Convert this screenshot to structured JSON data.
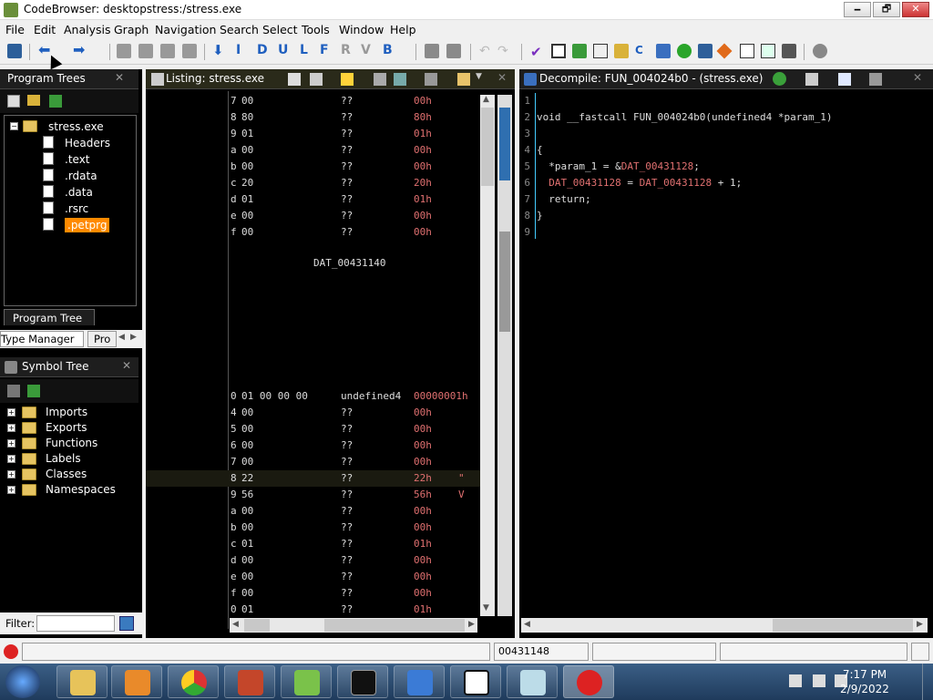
{
  "window": {
    "title": "CodeBrowser: desktopstress:/stress.exe",
    "min": "🗕",
    "max": "🗗",
    "close": "✕"
  },
  "menu": [
    "File",
    "Edit",
    "Analysis",
    "Graph",
    "Navigation",
    "Search",
    "Select",
    "Tools",
    "Window",
    "Help"
  ],
  "toolbar_letters": [
    "I",
    "D",
    "U",
    "L",
    "F",
    "R",
    "V",
    "B"
  ],
  "program_trees": {
    "title": "Program Trees",
    "root": "stress.exe",
    "items": [
      "Headers",
      ".text",
      ".rdata",
      ".data",
      ".rsrc",
      ".petprg"
    ],
    "tab": "Program Tree",
    "bottom_tabs": [
      "Type Manager",
      "Pro"
    ]
  },
  "symbol_tree": {
    "title": "Symbol Tree",
    "items": [
      "Imports",
      "Exports",
      "Functions",
      "Labels",
      "Classes",
      "Namespaces"
    ],
    "filter_label": "Filter:"
  },
  "listing": {
    "title": "Listing:  stress.exe",
    "rows_top": [
      {
        "a": "7",
        "b": "00",
        "q": "??",
        "v": "00h",
        "c": ""
      },
      {
        "a": "8",
        "b": "80",
        "q": "??",
        "v": "80h",
        "c": ""
      },
      {
        "a": "9",
        "b": "01",
        "q": "??",
        "v": "01h",
        "c": ""
      },
      {
        "a": "a",
        "b": "00",
        "q": "??",
        "v": "00h",
        "c": ""
      },
      {
        "a": "b",
        "b": "00",
        "q": "??",
        "v": "00h",
        "c": ""
      },
      {
        "a": "c",
        "b": "20",
        "q": "??",
        "v": "20h",
        "c": ""
      },
      {
        "a": "d",
        "b": "01",
        "q": "??",
        "v": "01h",
        "c": ""
      },
      {
        "a": "e",
        "b": "00",
        "q": "??",
        "v": "00h",
        "c": ""
      },
      {
        "a": "f",
        "b": "00",
        "q": "??",
        "v": "00h",
        "c": ""
      }
    ],
    "label": "DAT_00431140",
    "header_row": {
      "a": "0",
      "b": "01 00 00 00",
      "q": "undefined4",
      "v": "00000001h"
    },
    "rows_bottom": [
      {
        "a": "4",
        "b": "00",
        "q": "??",
        "v": "00h",
        "c": ""
      },
      {
        "a": "5",
        "b": "00",
        "q": "??",
        "v": "00h",
        "c": ""
      },
      {
        "a": "6",
        "b": "00",
        "q": "??",
        "v": "00h",
        "c": ""
      },
      {
        "a": "7",
        "b": "00",
        "q": "??",
        "v": "00h",
        "c": ""
      },
      {
        "a": "8",
        "b": "22",
        "q": "??",
        "v": "22h",
        "c": "\""
      },
      {
        "a": "9",
        "b": "56",
        "q": "??",
        "v": "56h",
        "c": "V"
      },
      {
        "a": "a",
        "b": "00",
        "q": "??",
        "v": "00h",
        "c": ""
      },
      {
        "a": "b",
        "b": "00",
        "q": "??",
        "v": "00h",
        "c": ""
      },
      {
        "a": "c",
        "b": "01",
        "q": "??",
        "v": "01h",
        "c": ""
      },
      {
        "a": "d",
        "b": "00",
        "q": "??",
        "v": "00h",
        "c": ""
      },
      {
        "a": "e",
        "b": "00",
        "q": "??",
        "v": "00h",
        "c": ""
      },
      {
        "a": "f",
        "b": "00",
        "q": "??",
        "v": "00h",
        "c": ""
      },
      {
        "a": "0",
        "b": "01",
        "q": "??",
        "v": "01h",
        "c": ""
      }
    ]
  },
  "decompile": {
    "title": "Decompile: FUN_004024b0 -  (stress.exe)",
    "line_numbers": [
      "1",
      "2",
      "3",
      "4",
      "5",
      "6",
      "7",
      "8",
      "9"
    ],
    "lines": [
      "",
      "void __fastcall FUN_004024b0(undefined4 *param_1)",
      "",
      "{",
      "  *param_1 = &DAT_00431128;",
      "  DAT_00431128 = DAT_00431128 + 1;",
      "  return;",
      "}",
      ""
    ]
  },
  "status": {
    "address": "00431148"
  },
  "taskbar": {
    "time": "7:17 PM",
    "date": "2/9/2022"
  },
  "colors": {
    "accent_selected": "#ff8a00",
    "global_symbol": "#e07070"
  }
}
